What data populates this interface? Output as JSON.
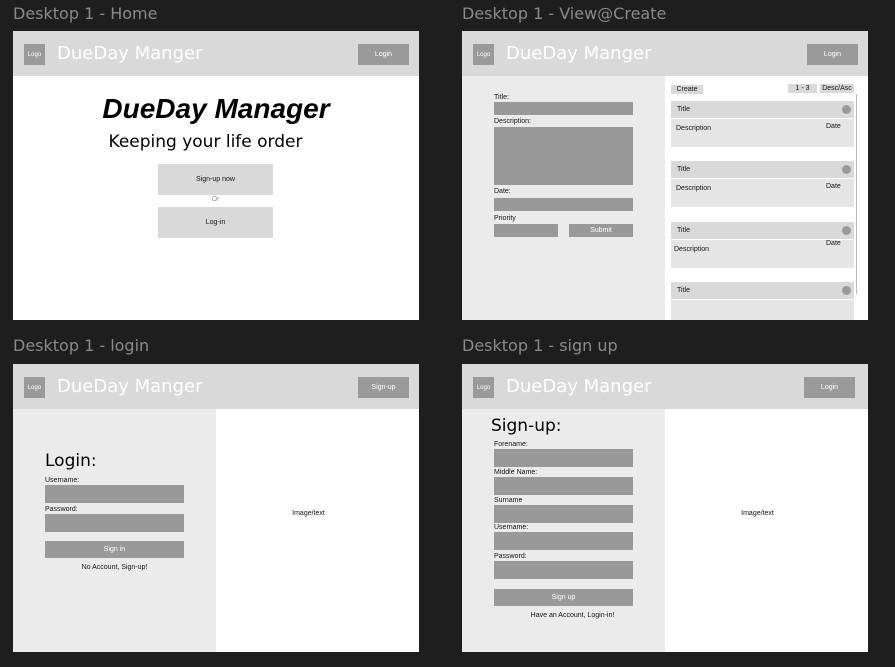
{
  "frames": {
    "home": {
      "label": "Desktop 1 - Home",
      "logo": "Logo",
      "brand": "DueDay Manger",
      "header_button": "Login",
      "title": "DueDay Manager",
      "subtitle": "Keeping your life order",
      "signup_button": "Sign-up now",
      "or_text": "Or",
      "login_button": "Log-in"
    },
    "view_create": {
      "label": "Desktop 1 - View@Create",
      "logo": "Logo",
      "brand": "DueDay Manger",
      "header_button": "Login",
      "form": {
        "title_label": "Title:",
        "description_label": "Description:",
        "date_label": "Date:",
        "priority_label": "Priority",
        "submit_button": "Submit"
      },
      "list": {
        "create_button": "Create",
        "page_range": "1 - 3",
        "sort_toggle": "Desc/Asc",
        "cards": [
          {
            "title": "Title",
            "description": "Description",
            "date": "Date"
          },
          {
            "title": "Title",
            "description": "Description",
            "date": "Date"
          },
          {
            "title": "Title",
            "description": "Description",
            "date": "Date"
          },
          {
            "title": "Title",
            "description": "",
            "date": ""
          }
        ]
      }
    },
    "login": {
      "label": "Desktop 1 - login",
      "logo": "Logo",
      "brand": "DueDay Manger",
      "header_button": "Sign-up",
      "heading": "Login:",
      "username_label": "Username:",
      "password_label": "Password:",
      "signin_button": "Sign in",
      "footer_link": "No Account, Sign-up!",
      "image_text": "Image/text"
    },
    "signup": {
      "label": "Desktop 1 - sign up",
      "logo": "Logo",
      "brand": "DueDay Manger",
      "header_button": "Login",
      "heading": "Sign-up:",
      "forename_label": "Forename:",
      "middle_name_label": "Middle Name:",
      "surname_label": "Surname",
      "username_label": "Username:",
      "password_label": "Password:",
      "signup_button": "Sign up",
      "footer_link": "Have an Account, Login-in!",
      "image_text": "Image/text"
    }
  },
  "colors": {
    "canvas": "#1e1e1e",
    "header": "#d9d9d9",
    "placeholder": "#999999",
    "panel": "#ebebeb"
  }
}
